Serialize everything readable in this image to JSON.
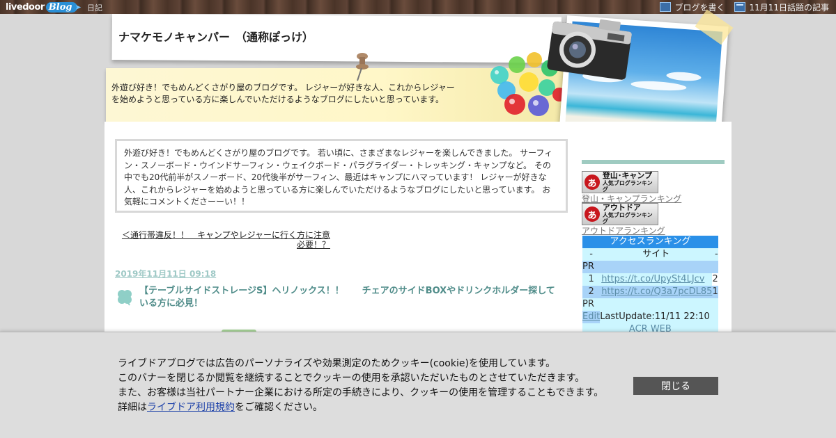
{
  "topbar": {
    "logo_text_1": "livedoor",
    "logo_text_2": "Blog",
    "diary_link": "日記",
    "write_blog": "ブログを書く",
    "trending": "11月11日話題の記事"
  },
  "header": {
    "blog_title": "ナマケモノキャンパー　（通称ぽっけ）",
    "description": "外遊び好き！でもめんどくさがり屋のブログです。 レジャーが好きな人、これからレジャーを始めようと思っている方に楽しんでいただけるようなブログにしたいと思っています。"
  },
  "main": {
    "intro": "外遊び好き！でもめんどくさがり屋のブログです。 若い頃に、さまざまなレジャーを楽しんできました。 サーフィン・スノーボード・ウインドサーフィン・ウェイクボード・パラグライダー・トレッキング・キャンプなど。 その中でも20代前半がスノーボード、20代後半がサーフィン、最近はキャンプにハマっています！ レジャーが好きな人、これからレジャーを始めようと思っている方に楽しんでいただけるようなブログにしたいと思っています。 お気軽にコメントくださーーい！！",
    "prev_post": "＜通行帯違反！！　キャンプやレジャーに行く方に注意必要！？",
    "post_date": "2019年11月11日 09:18",
    "post_title": "【テーブルサイドストレージS】ヘリノックス！！　　チェアのサイドBOXやドリンクホルダー探している方に必見！"
  },
  "sidebar": {
    "banner1_big": "登山･キャンプ",
    "banner1_small": "人気ブログランキング",
    "banner1_link": "登山・キャンプランキング",
    "banner2_big": "アウトドア",
    "banner2_small": "人気ブログランキング",
    "banner2_link": "アウトドアランキング",
    "access": {
      "title": "アクセスランキング",
      "col_rank": "-",
      "col_site": "サイト",
      "col_count": "-",
      "pr1": "PR",
      "rows": [
        {
          "rank": "1",
          "url": "https://t.co/UpySt4LJcv",
          "count": "2"
        },
        {
          "rank": "2",
          "url": "https://t.co/Q3a7pcDL85",
          "count": "1"
        }
      ],
      "pr2": "PR",
      "edit": "Edit",
      "last_update": "LastUpdate:11/11 22:10",
      "footer": "ACR WEB"
    }
  },
  "cookie": {
    "line1": "ライブドアブログでは広告のパーソナライズや効果測定のためクッキー(cookie)を使用しています。",
    "line2": "このバナーを閉じるか閲覧を継続することでクッキーの使用を承認いただいたものとさせていただきます。",
    "line3": "また、お客様は当社パートナー企業における所定の手続きにより、クッキーの使用を管理することもできます。",
    "line4_prefix": "詳細は",
    "line4_link": "ライブドア利用規約",
    "line4_suffix": "をご確認ください。",
    "close_button": "閉じる"
  },
  "colors": {
    "post_title": "#4f8c89",
    "post_date": "#9fc9c6",
    "access_header": "#2a90e8",
    "cookie_button": "#555555"
  }
}
